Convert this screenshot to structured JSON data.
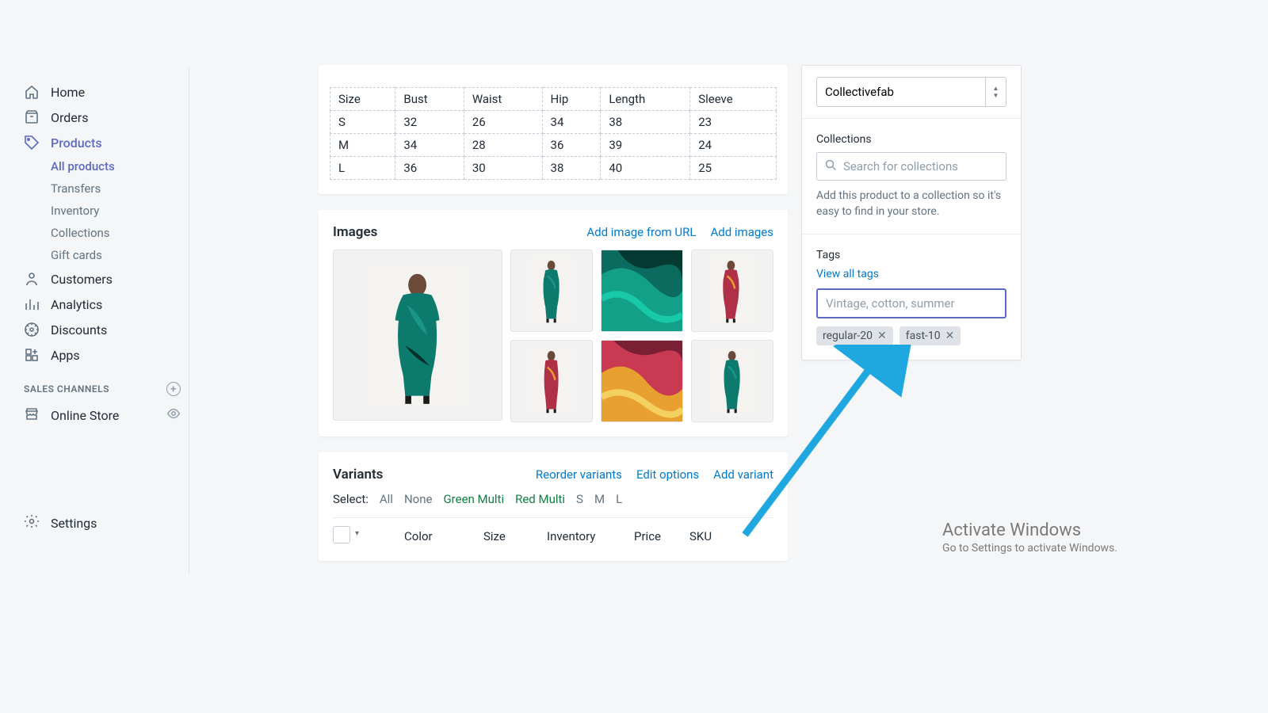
{
  "sidebar": {
    "items": [
      {
        "label": "Home"
      },
      {
        "label": "Orders"
      },
      {
        "label": "Products"
      },
      {
        "label": "Customers"
      },
      {
        "label": "Analytics"
      },
      {
        "label": "Discounts"
      },
      {
        "label": "Apps"
      }
    ],
    "products_sub": [
      {
        "label": "All products"
      },
      {
        "label": "Transfers"
      },
      {
        "label": "Inventory"
      },
      {
        "label": "Collections"
      },
      {
        "label": "Gift cards"
      }
    ],
    "sales_channels_title": "SALES CHANNELS",
    "online_store": "Online Store",
    "settings": "Settings"
  },
  "size_table": {
    "headers": [
      "Size",
      "Bust",
      "Waist",
      "Hip",
      "Length",
      "Sleeve"
    ],
    "rows": [
      [
        "S",
        "32",
        "26",
        "34",
        "38",
        "23"
      ],
      [
        "M",
        "34",
        "28",
        "36",
        "39",
        "24"
      ],
      [
        "L",
        "36",
        "30",
        "38",
        "40",
        "25"
      ]
    ]
  },
  "images_section": {
    "title": "Images",
    "link_url": "Add image from URL",
    "link_add": "Add images"
  },
  "variants_section": {
    "title": "Variants",
    "reorder": "Reorder variants",
    "edit": "Edit options",
    "add": "Add variant",
    "select_label": "Select:",
    "options": [
      "All",
      "None",
      "Green Multi",
      "Red Multi",
      "S",
      "M",
      "L"
    ],
    "columns": [
      "Color",
      "Size",
      "Inventory",
      "Price",
      "SKU"
    ]
  },
  "right": {
    "vendor": "Collectivefab",
    "collections_label": "Collections",
    "collections_placeholder": "Search for collections",
    "collections_help": "Add this product to a collection so it's easy to find in your store.",
    "tags_label": "Tags",
    "view_all": "View all tags",
    "tags_placeholder": "Vintage, cotton, summer",
    "tags": [
      "regular-20",
      "fast-10"
    ]
  },
  "activate": {
    "title": "Activate Windows",
    "sub": "Go to Settings to activate Windows."
  }
}
